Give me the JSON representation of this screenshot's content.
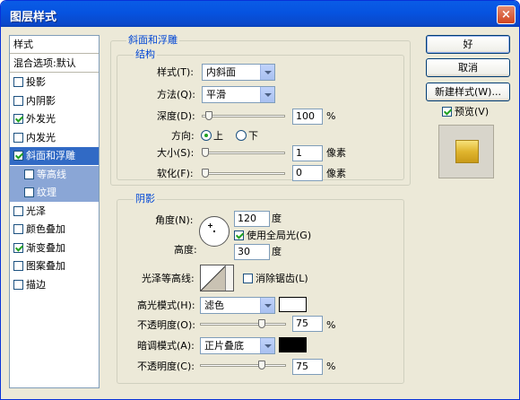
{
  "window": {
    "title": "图层样式",
    "close_glyph": "×"
  },
  "sidebar": {
    "header": "样式",
    "blend_options": "混合选项:默认",
    "items": [
      {
        "label": "投影",
        "checked": false
      },
      {
        "label": "内阴影",
        "checked": false
      },
      {
        "label": "外发光",
        "checked": true
      },
      {
        "label": "内发光",
        "checked": false
      },
      {
        "label": "斜面和浮雕",
        "checked": true,
        "selected": true
      },
      {
        "label": "等高线",
        "checked": false,
        "sub": true
      },
      {
        "label": "纹理",
        "checked": false,
        "sub": true
      },
      {
        "label": "光泽",
        "checked": false
      },
      {
        "label": "颜色叠加",
        "checked": false
      },
      {
        "label": "渐变叠加",
        "checked": true
      },
      {
        "label": "图案叠加",
        "checked": false
      },
      {
        "label": "描边",
        "checked": false
      }
    ]
  },
  "bevel": {
    "group_title": "斜面和浮雕",
    "structure_title": "结构",
    "style_label": "样式(T):",
    "style_value": "内斜面",
    "technique_label": "方法(Q):",
    "technique_value": "平滑",
    "depth_label": "深度(D):",
    "depth_value": "100",
    "depth_level": 0.05,
    "percent": "%",
    "direction_label": "方向:",
    "direction_up": "上",
    "direction_down": "下",
    "size_label": "大小(S):",
    "size_value": "1",
    "size_level": 0.0,
    "size_unit": "像素",
    "soften_label": "软化(F):",
    "soften_value": "0",
    "soften_level": 0.0,
    "soften_unit": "像素"
  },
  "shading": {
    "group_title": "阴影",
    "angle_label": "角度(N):",
    "angle_value": "120",
    "degree": "度",
    "global_light_label": "使用全局光(G)",
    "global_light_checked": true,
    "altitude_label": "高度:",
    "altitude_value": "30",
    "gloss_label": "光泽等高线:",
    "antialias_label": "消除锯齿(L)",
    "antialias_checked": false,
    "highlight_mode_label": "高光模式(H):",
    "highlight_mode_value": "滤色",
    "highlight_color": "#ffffff",
    "highlight_opacity_label": "不透明度(O):",
    "highlight_opacity_value": "75",
    "highlight_opacity_level": 0.75,
    "shadow_mode_label": "暗调模式(A):",
    "shadow_mode_value": "正片叠底",
    "shadow_color": "#000000",
    "shadow_opacity_label": "不透明度(C):",
    "shadow_opacity_value": "75",
    "shadow_opacity_level": 0.75,
    "percent": "%"
  },
  "buttons": {
    "ok": "好",
    "cancel": "取消",
    "new_style": "新建样式(W)...",
    "preview_label": "预览(V)",
    "preview_checked": true
  },
  "colors": {
    "accent": "#316ac5",
    "title_bar": "#0a5ce6",
    "preview_gold": "#e8c23a"
  }
}
